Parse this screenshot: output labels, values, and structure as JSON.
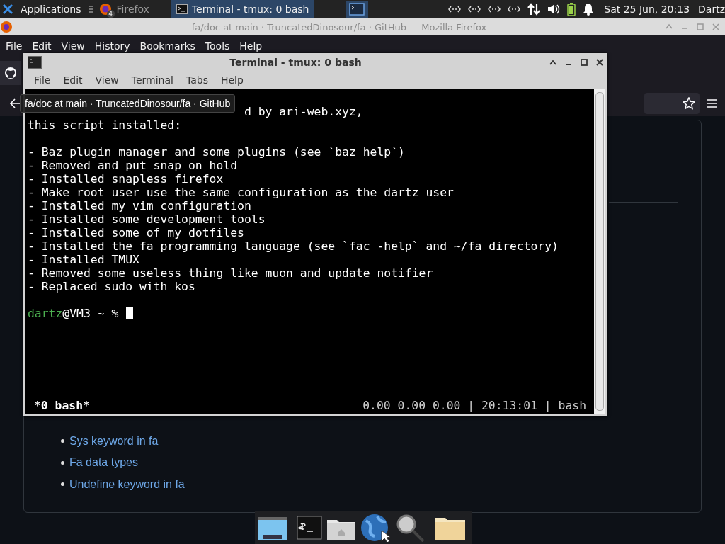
{
  "top_panel": {
    "apps_label": "Applications",
    "tasks": [
      {
        "kind": "firefox",
        "label": "Firefox",
        "badge": "4",
        "selected": false
      },
      {
        "kind": "terminal",
        "label": "Terminal - tmux: 0 bash",
        "selected": true
      }
    ],
    "clock": "Sat 25 Jun, 20:13",
    "user": "Dartz"
  },
  "firefox": {
    "title": "fa/doc at main · TruncatedDinosour/fa · GitHub — Mozilla Firefox",
    "menu": [
      "File",
      "Edit",
      "View",
      "History",
      "Bookmarks",
      "Tools",
      "Help"
    ],
    "tooltip": "fa/doc at main · TruncatedDinosour/fa · GitHub",
    "links": [
      "Sys keyword in fa",
      "Fa data types",
      "Undefine keyword in fa"
    ]
  },
  "terminal": {
    "title": "Terminal - tmux: 0 bash",
    "menu": [
      "File",
      "Edit",
      "View",
      "Terminal",
      "Tabs",
      "Help"
    ],
    "lines": [
      {
        "kind": "blank"
      },
      {
        "kind": "tail",
        "text": "d by ari-web.xyz,"
      },
      {
        "kind": "text",
        "text": "this script installed:"
      },
      {
        "kind": "blank"
      },
      {
        "kind": "text",
        "text": "- Baz plugin manager and some plugins (see `baz help`)"
      },
      {
        "kind": "text",
        "text": "- Removed and put snap on hold"
      },
      {
        "kind": "text",
        "text": "- Installed snapless firefox"
      },
      {
        "kind": "text",
        "text": "- Make root user use the same configuration as the dartz user"
      },
      {
        "kind": "text",
        "text": "- Installed my vim configuration"
      },
      {
        "kind": "text",
        "text": "- Installed some development tools"
      },
      {
        "kind": "text",
        "text": "- Installed some of my dotfiles"
      },
      {
        "kind": "text",
        "text": "- Installed the fa programming language (see `fac -help` and ~/fa directory)"
      },
      {
        "kind": "text",
        "text": "- Installed TMUX"
      },
      {
        "kind": "text",
        "text": "- Removed some useless thing like muon and update notifier"
      },
      {
        "kind": "text",
        "text": "- Replaced sudo with kos"
      },
      {
        "kind": "blank"
      },
      {
        "kind": "prompt",
        "user": "dartz",
        "rest": "@VM3 ~ %"
      }
    ],
    "status_left": "*0 bash*",
    "status_right": "0.00 0.00 0.00 | 20:13:01 | bash"
  }
}
